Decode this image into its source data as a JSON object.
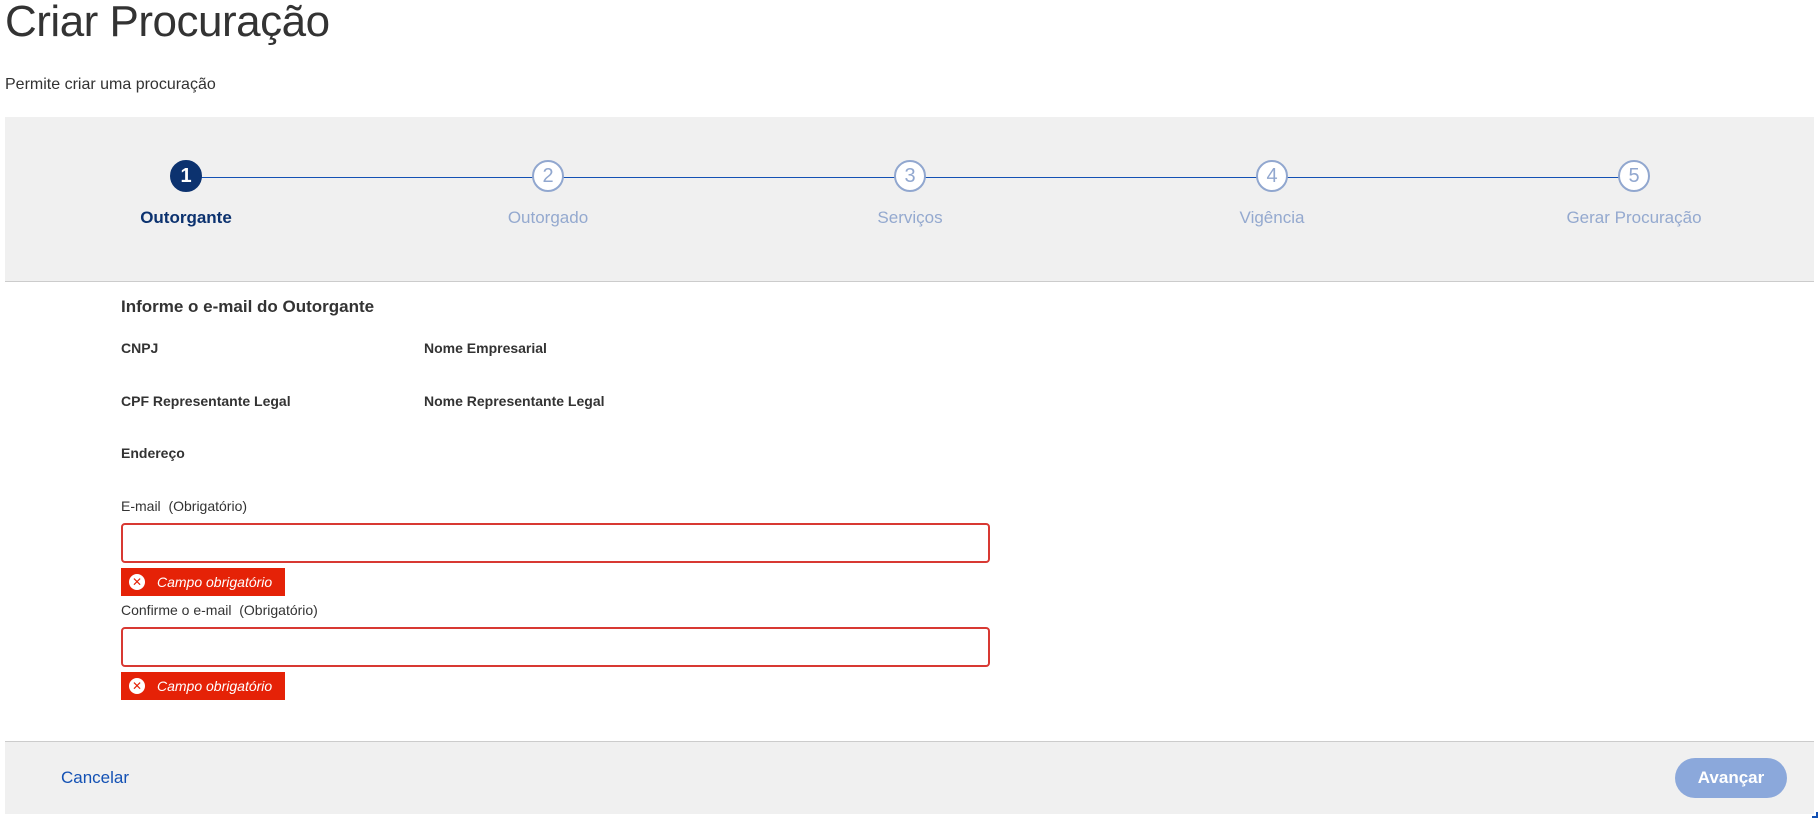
{
  "page": {
    "title": "Criar Procuração",
    "subtitle": "Permite criar uma procuração"
  },
  "wizard": {
    "active_step": 1,
    "steps": [
      {
        "number": "1",
        "label": "Outorgante"
      },
      {
        "number": "2",
        "label": "Outorgado"
      },
      {
        "number": "3",
        "label": "Serviços"
      },
      {
        "number": "4",
        "label": "Vigência"
      },
      {
        "number": "5",
        "label": "Gerar Procuração"
      }
    ]
  },
  "form": {
    "heading": "Informe o e-mail do Outorgante",
    "fields": {
      "cnpj": "CNPJ",
      "nome_empresarial": "Nome Empresarial",
      "cpf_representante": "CPF Representante Legal",
      "nome_representante": "Nome Representante Legal",
      "endereco": "Endereço"
    },
    "email": {
      "label": "E-mail  (Obrigatório)",
      "value": "",
      "error": "Campo obrigatório"
    },
    "email_confirm": {
      "label": "Confirme o e-mail  (Obrigatório)",
      "value": "",
      "error": "Campo obrigatório"
    }
  },
  "footer": {
    "cancel_label": "Cancelar",
    "next_label": "Avançar"
  },
  "colors": {
    "primary": "#1351b4",
    "active_step": "#0c326f",
    "inactive_step": "#91a7cf",
    "error": "#e52207",
    "input_error_border": "#d83933",
    "disabled_button": "#8ba8db",
    "panel_background": "#f0f0f0"
  }
}
